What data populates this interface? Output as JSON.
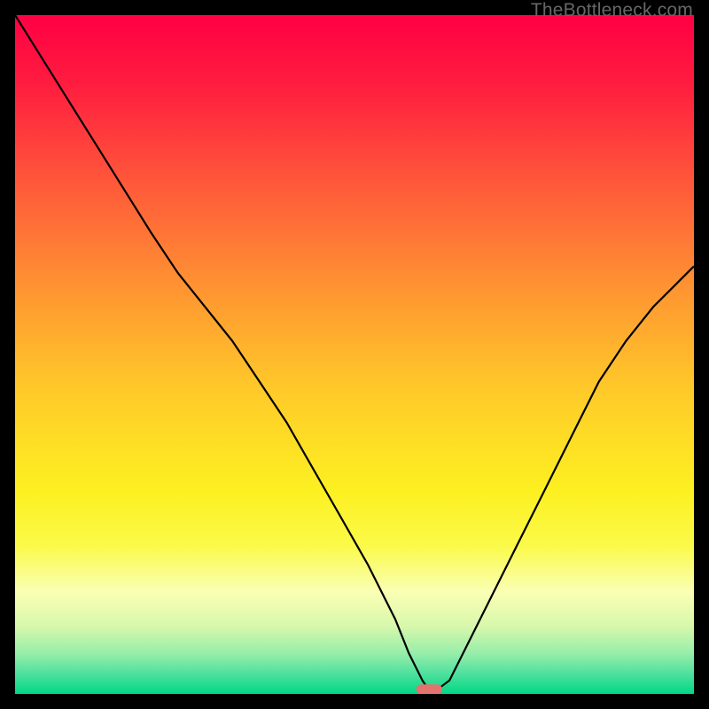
{
  "watermark": "TheBottleneck.com",
  "chart_data": {
    "type": "line",
    "title": "",
    "xlabel": "",
    "ylabel": "",
    "xlim": [
      0,
      100
    ],
    "ylim": [
      0,
      100
    ],
    "background_gradient": {
      "stops": [
        {
          "pos": 0.0,
          "color": "#ff0044"
        },
        {
          "pos": 0.1,
          "color": "#ff1c3f"
        },
        {
          "pos": 0.25,
          "color": "#ff593a"
        },
        {
          "pos": 0.4,
          "color": "#ff9332"
        },
        {
          "pos": 0.55,
          "color": "#ffc929"
        },
        {
          "pos": 0.7,
          "color": "#fdf021"
        },
        {
          "pos": 0.78,
          "color": "#fbfa48"
        },
        {
          "pos": 0.85,
          "color": "#faffb4"
        },
        {
          "pos": 0.9,
          "color": "#d8f8ac"
        },
        {
          "pos": 0.94,
          "color": "#97eeaa"
        },
        {
          "pos": 0.97,
          "color": "#4fe09e"
        },
        {
          "pos": 1.0,
          "color": "#00d884"
        }
      ]
    },
    "series": [
      {
        "name": "bottleneck-curve",
        "color": "#000000",
        "x": [
          0,
          5,
          10,
          15,
          20,
          24,
          28,
          32,
          36,
          40,
          44,
          48,
          52,
          56,
          58,
          60,
          61,
          62,
          64,
          67,
          70,
          74,
          78,
          82,
          86,
          90,
          94,
          98,
          100
        ],
        "values": [
          100,
          92,
          84,
          76,
          68,
          62,
          57,
          52,
          46,
          40,
          33,
          26,
          19,
          11,
          6,
          2,
          0.5,
          0.5,
          2,
          8,
          14,
          22,
          30,
          38,
          46,
          52,
          57,
          61,
          63
        ]
      }
    ],
    "marker": {
      "name": "optimal-point",
      "x": 61,
      "y": 0,
      "width_pct": 3.8,
      "height_pct": 1.4,
      "color": "#e4726f"
    }
  }
}
